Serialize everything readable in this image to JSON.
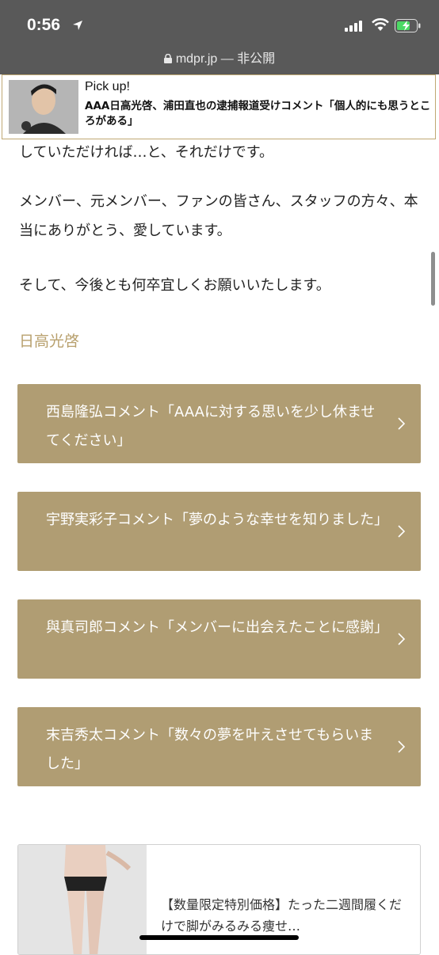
{
  "status_bar": {
    "time": "0:56"
  },
  "browser": {
    "domain": "mdpr.jp",
    "privacy": "— 非公開"
  },
  "pickup": {
    "label": "Pick up!",
    "title": "AAA日高光啓、浦田直也の逮捕報道受けコメント「個人的にも思うところがある」"
  },
  "article": {
    "partial_line": "していただければ…と、それだけです。",
    "para1": "メンバー、元メンバー、ファンの皆さん、スタッフの方々、本当にありがとう、愛しています。",
    "para2": "そして、今後とも何卒宜しくお願いいたします。",
    "author": "日高光啓"
  },
  "related_links": [
    {
      "label": "西島隆弘コメント「AAAに対する思いを少し休ませてください」"
    },
    {
      "label": "宇野実彩子コメント「夢のような幸せを知りました」"
    },
    {
      "label": "與真司郎コメント「メンバーに出会えたことに感謝」"
    },
    {
      "label": "末吉秀太コメント「数々の夢を叶えさせてもらいました」"
    }
  ],
  "ad": {
    "text": "【数量限定特別価格】たった二週間履くだけで脚がみるみる痩せ…"
  },
  "colors": {
    "chrome_bg": "#595959",
    "accent_gold": "#b09d73",
    "author_text": "#b8a06d"
  }
}
